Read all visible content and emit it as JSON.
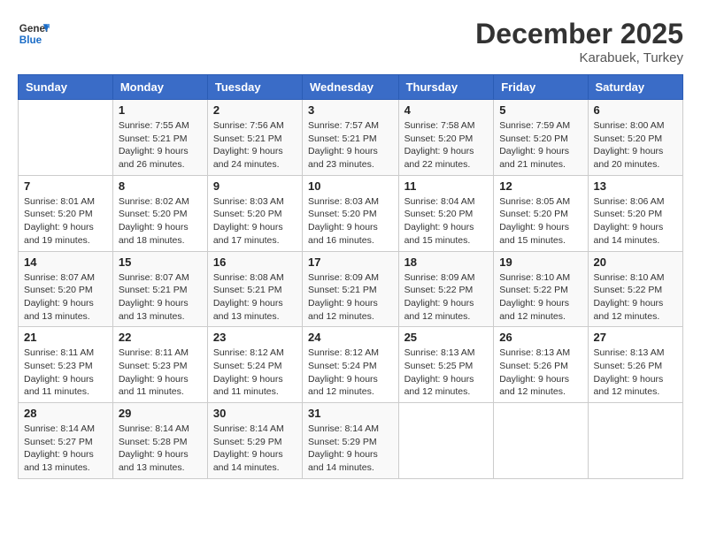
{
  "header": {
    "logo_line1": "General",
    "logo_line2": "Blue",
    "month_year": "December 2025",
    "location": "Karabuek, Turkey"
  },
  "weekdays": [
    "Sunday",
    "Monday",
    "Tuesday",
    "Wednesday",
    "Thursday",
    "Friday",
    "Saturday"
  ],
  "weeks": [
    [
      {
        "num": "",
        "info": ""
      },
      {
        "num": "1",
        "info": "Sunrise: 7:55 AM\nSunset: 5:21 PM\nDaylight: 9 hours\nand 26 minutes."
      },
      {
        "num": "2",
        "info": "Sunrise: 7:56 AM\nSunset: 5:21 PM\nDaylight: 9 hours\nand 24 minutes."
      },
      {
        "num": "3",
        "info": "Sunrise: 7:57 AM\nSunset: 5:21 PM\nDaylight: 9 hours\nand 23 minutes."
      },
      {
        "num": "4",
        "info": "Sunrise: 7:58 AM\nSunset: 5:20 PM\nDaylight: 9 hours\nand 22 minutes."
      },
      {
        "num": "5",
        "info": "Sunrise: 7:59 AM\nSunset: 5:20 PM\nDaylight: 9 hours\nand 21 minutes."
      },
      {
        "num": "6",
        "info": "Sunrise: 8:00 AM\nSunset: 5:20 PM\nDaylight: 9 hours\nand 20 minutes."
      }
    ],
    [
      {
        "num": "7",
        "info": "Sunrise: 8:01 AM\nSunset: 5:20 PM\nDaylight: 9 hours\nand 19 minutes."
      },
      {
        "num": "8",
        "info": "Sunrise: 8:02 AM\nSunset: 5:20 PM\nDaylight: 9 hours\nand 18 minutes."
      },
      {
        "num": "9",
        "info": "Sunrise: 8:03 AM\nSunset: 5:20 PM\nDaylight: 9 hours\nand 17 minutes."
      },
      {
        "num": "10",
        "info": "Sunrise: 8:03 AM\nSunset: 5:20 PM\nDaylight: 9 hours\nand 16 minutes."
      },
      {
        "num": "11",
        "info": "Sunrise: 8:04 AM\nSunset: 5:20 PM\nDaylight: 9 hours\nand 15 minutes."
      },
      {
        "num": "12",
        "info": "Sunrise: 8:05 AM\nSunset: 5:20 PM\nDaylight: 9 hours\nand 15 minutes."
      },
      {
        "num": "13",
        "info": "Sunrise: 8:06 AM\nSunset: 5:20 PM\nDaylight: 9 hours\nand 14 minutes."
      }
    ],
    [
      {
        "num": "14",
        "info": "Sunrise: 8:07 AM\nSunset: 5:20 PM\nDaylight: 9 hours\nand 13 minutes."
      },
      {
        "num": "15",
        "info": "Sunrise: 8:07 AM\nSunset: 5:21 PM\nDaylight: 9 hours\nand 13 minutes."
      },
      {
        "num": "16",
        "info": "Sunrise: 8:08 AM\nSunset: 5:21 PM\nDaylight: 9 hours\nand 13 minutes."
      },
      {
        "num": "17",
        "info": "Sunrise: 8:09 AM\nSunset: 5:21 PM\nDaylight: 9 hours\nand 12 minutes."
      },
      {
        "num": "18",
        "info": "Sunrise: 8:09 AM\nSunset: 5:22 PM\nDaylight: 9 hours\nand 12 minutes."
      },
      {
        "num": "19",
        "info": "Sunrise: 8:10 AM\nSunset: 5:22 PM\nDaylight: 9 hours\nand 12 minutes."
      },
      {
        "num": "20",
        "info": "Sunrise: 8:10 AM\nSunset: 5:22 PM\nDaylight: 9 hours\nand 12 minutes."
      }
    ],
    [
      {
        "num": "21",
        "info": "Sunrise: 8:11 AM\nSunset: 5:23 PM\nDaylight: 9 hours\nand 11 minutes."
      },
      {
        "num": "22",
        "info": "Sunrise: 8:11 AM\nSunset: 5:23 PM\nDaylight: 9 hours\nand 11 minutes."
      },
      {
        "num": "23",
        "info": "Sunrise: 8:12 AM\nSunset: 5:24 PM\nDaylight: 9 hours\nand 11 minutes."
      },
      {
        "num": "24",
        "info": "Sunrise: 8:12 AM\nSunset: 5:24 PM\nDaylight: 9 hours\nand 12 minutes."
      },
      {
        "num": "25",
        "info": "Sunrise: 8:13 AM\nSunset: 5:25 PM\nDaylight: 9 hours\nand 12 minutes."
      },
      {
        "num": "26",
        "info": "Sunrise: 8:13 AM\nSunset: 5:26 PM\nDaylight: 9 hours\nand 12 minutes."
      },
      {
        "num": "27",
        "info": "Sunrise: 8:13 AM\nSunset: 5:26 PM\nDaylight: 9 hours\nand 12 minutes."
      }
    ],
    [
      {
        "num": "28",
        "info": "Sunrise: 8:14 AM\nSunset: 5:27 PM\nDaylight: 9 hours\nand 13 minutes."
      },
      {
        "num": "29",
        "info": "Sunrise: 8:14 AM\nSunset: 5:28 PM\nDaylight: 9 hours\nand 13 minutes."
      },
      {
        "num": "30",
        "info": "Sunrise: 8:14 AM\nSunset: 5:29 PM\nDaylight: 9 hours\nand 14 minutes."
      },
      {
        "num": "31",
        "info": "Sunrise: 8:14 AM\nSunset: 5:29 PM\nDaylight: 9 hours\nand 14 minutes."
      },
      {
        "num": "",
        "info": ""
      },
      {
        "num": "",
        "info": ""
      },
      {
        "num": "",
        "info": ""
      }
    ]
  ]
}
